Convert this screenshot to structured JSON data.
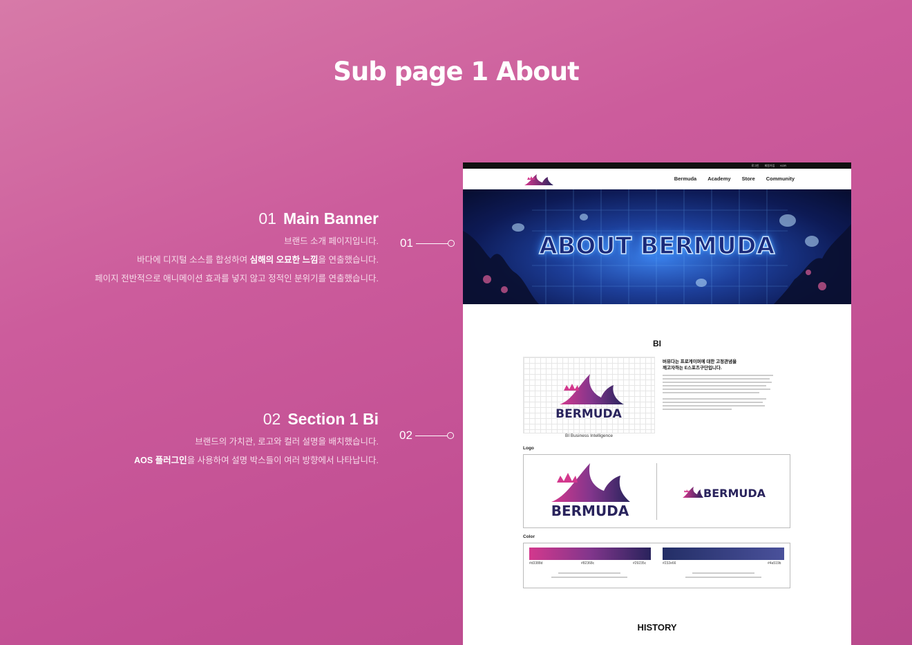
{
  "page_title": "Sub page 1  About",
  "annotations": [
    {
      "num": "01",
      "title": "Main Banner",
      "lines": [
        "브랜드 소개 페이지입니다."
      ],
      "line2_pre": "바다에 디지털 소스를 합성하여 ",
      "line2_bold": "심해의 오묘한 느낌",
      "line2_post": "을 연출했습니다.",
      "line3": "페이지 전반적으로 애니메이션 효과를 넣지 않고 정적인 분위기를 연출했습니다.",
      "marker": "01"
    },
    {
      "num": "02",
      "title": "Section 1  Bi",
      "line1": "브랜드의 가치관, 로고와 컬러 설명을 배치했습니다.",
      "line2_bold": "AOS 플러그인",
      "line2_post": "을 사용하여 설명 박스들이 여러 방향에서 나타납니다.",
      "marker": "02"
    }
  ],
  "mock": {
    "util_links": [
      "로그인",
      "회원가입",
      "KOR"
    ],
    "nav": [
      "Bermuda",
      "Academy",
      "Store",
      "Community"
    ],
    "banner_title": "ABOUT BERMUDA",
    "bi_title": "BI",
    "bi_head_1": "버뮤다는 프로게이머에 대한 고정관념을",
    "bi_head_2": "깨고자하는 E스포츠구단입니다.",
    "bi_body": "",
    "bi_caption": "BI Business Intelligence",
    "logo_label": "Logo",
    "wordmark": "BERMUDA",
    "color_label": "Color",
    "colors": {
      "grad1_start": "#d3388d",
      "grad1_mid": "#82368c",
      "grad1_end": "#29235c",
      "grad2_start": "#232e66",
      "grad2_end": "#4a519b"
    },
    "hex_labels": [
      "#d3388d",
      "#82368c",
      "#29235c",
      "#232e66",
      "#4a519b"
    ],
    "color_desc_1": "",
    "color_desc_2": "",
    "history_title": "HISTORY"
  }
}
